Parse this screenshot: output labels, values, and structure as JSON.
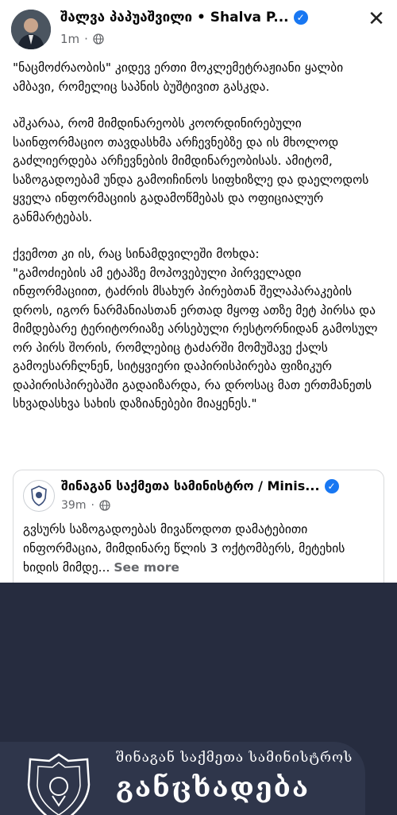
{
  "post": {
    "author": "შალვა პაპუაშვილი • Shalva P...",
    "time": "1m",
    "close_icon": "✕",
    "paragraphs": [
      "\"ნაცმოძრაობის\" კიდევ ერთი მოკლემეტრაჟიანი ყალბი ამბავი, რომელიც საპნის ბუშტივით გასკდა.",
      "აშკარაა, რომ მიმდინარეობს კოორდინირებული საინფორმაციო თავდასხმა არჩევნებზე და ის მხოლოდ გაძლიერდება არჩევნების მიმდინარეობისას. ამიტომ, საზოგადოებამ  უნდა გამოიჩინოს სიფხიზლე და დაელოდოს ყველა ინფორმაციის გადამოწმებას და ოფიციალურ განმარტებას.",
      "ქვემოთ კი ის, რაც სინამდვილეში მოხდა:\n\"გამოძიების ამ ეტაპზე მოპოვებული პირველადი ინფორმაციით, ტაძრის მსახურ პირებთან შელაპარაკების დროს, იგორ ნარმანიასთან ერთად მყოფ ათზე მეტ პირსა და მიმდებარე ტერიტორიაზე არსებული რესტორნიდან გამოსულ ორ პირს შორის, რომლებიც ტაძარში მომუშავე ქალს გამოესარჩლნენ, სიტყვიერი დაპირისპირება ფიზიკურ დაპირისპირებაში გადაიზარდა, რა დროსაც მათ ერთმანეთს სხვადასხვა სახის დაზიანებები მიაყენეს.\""
    ]
  },
  "shared_post": {
    "author": "შინაგან საქმეთა სამინისტრო / Minis...",
    "time": "39m",
    "text": "გვსურს საზოგადოებას მივაწოდოთ დამატებითი ინფორმაცია, მიმდინარე წლის 3 ოქტომბერს,  მეტეხის ხიდის მიმდე...",
    "see_more": "See more"
  },
  "banner": {
    "subtitle": "შინაგან საქმეთა სამინისტროს",
    "title": "განცხადება"
  },
  "icons": {
    "verified": "verified-badge-icon",
    "globe": "globe-icon",
    "close": "close-icon",
    "emblem": "ministry-emblem-icon"
  },
  "colors": {
    "verified": "#1877f2",
    "banner_bg": "#262c3f",
    "muted": "#65676b"
  }
}
